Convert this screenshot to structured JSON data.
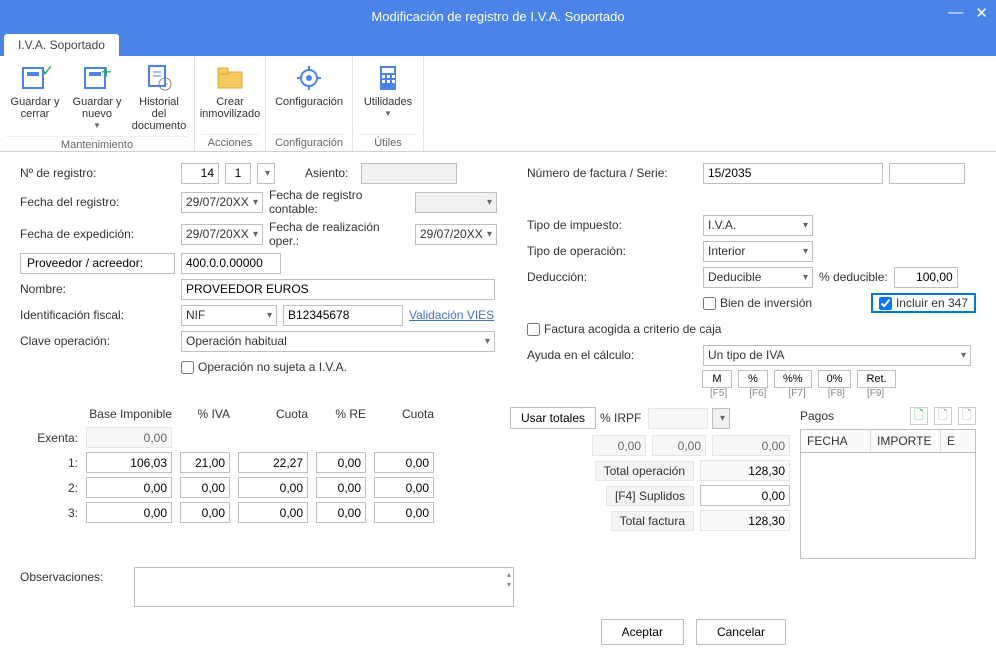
{
  "window": {
    "title": "Modificación de registro de I.V.A. Soportado"
  },
  "tab": {
    "label": "I.V.A. Soportado"
  },
  "ribbon": {
    "groups": [
      {
        "label": "Mantenimiento",
        "items": [
          {
            "label": "Guardar y cerrar",
            "dd": false
          },
          {
            "label": "Guardar y nuevo",
            "dd": true
          },
          {
            "label": "Historial del documento",
            "dd": false
          }
        ]
      },
      {
        "label": "Acciones",
        "items": [
          {
            "label": "Crear inmovilizado",
            "dd": false
          }
        ]
      },
      {
        "label": "Configuración",
        "items": [
          {
            "label": "Configuración",
            "dd": false
          }
        ]
      },
      {
        "label": "Útiles",
        "items": [
          {
            "label": "Utilidades",
            "dd": true
          }
        ]
      }
    ]
  },
  "left": {
    "nregistro_lbl": "Nº de registro:",
    "nregistro_val": "14",
    "nregistro_sub": "1",
    "fecha_registro_lbl": "Fecha del registro:",
    "fecha_registro_val": "29/07/20XX",
    "fecha_expedicion_lbl": "Fecha de expedición:",
    "fecha_expedicion_val": "29/07/20XX",
    "proveedor_btn": "Proveedor / acreedor:",
    "proveedor_val": "400.0.0.00000",
    "nombre_lbl": "Nombre:",
    "nombre_val": "PROVEEDOR EUROS",
    "id_fiscal_lbl": "Identificación fiscal:",
    "id_fiscal_tipo": "NIF",
    "id_fiscal_val": "B12345678",
    "validacion_link": "Validación VIES",
    "clave_lbl": "Clave operación:",
    "clave_val": "Operación habitual",
    "op_no_sujeta": "Operación no sujeta a I.V.A.",
    "asiento_lbl": "Asiento:",
    "fecha_contable_lbl": "Fecha de registro contable:",
    "fecha_realizacion_lbl": "Fecha de realización oper.:",
    "fecha_realizacion_val": "29/07/20XX"
  },
  "right": {
    "factura_lbl": "Número de factura / Serie:",
    "factura_val": "15/2035",
    "tipo_impuesto_lbl": "Tipo de impuesto:",
    "tipo_impuesto_val": "I.V.A.",
    "tipo_op_lbl": "Tipo de operación:",
    "tipo_op_val": "Interior",
    "deduccion_lbl": "Deducción:",
    "deduccion_val": "Deducible",
    "pct_deducible_lbl": "% deducible:",
    "pct_deducible_val": "100,00",
    "bien_inversion": "Bien de inversión",
    "incluir_347": "Incluir en 347",
    "criterio_caja": "Factura acogida a criterio de caja",
    "ayuda_lbl": "Ayuda en el cálculo:",
    "ayuda_val": "Un tipo de IVA",
    "shortcuts": [
      "M",
      "%",
      "%%",
      "0%",
      "Ret."
    ],
    "shortcut_keys": [
      "[F5]",
      "[F6]",
      "[F7]",
      "[F8]",
      "[F9]"
    ]
  },
  "grid": {
    "headers": {
      "base": "Base Imponible",
      "iva": "% IVA",
      "cuota": "Cuota",
      "re": "% RE",
      "cuota2": "Cuota",
      "usar": "Usar totales",
      "irpf": "% IRPF"
    },
    "rows": [
      {
        "lbl": "Exenta:",
        "base": "0,00",
        "iva": "",
        "cuota": "",
        "re": "",
        "cuota2": ""
      },
      {
        "lbl": "1:",
        "base": "106,03",
        "iva": "21,00",
        "cuota": "22,27",
        "re": "0,00",
        "cuota2": "0,00"
      },
      {
        "lbl": "2:",
        "base": "0,00",
        "iva": "0,00",
        "cuota": "0,00",
        "re": "0,00",
        "cuota2": "0,00"
      },
      {
        "lbl": "3:",
        "base": "0,00",
        "iva": "0,00",
        "cuota": "0,00",
        "re": "0,00",
        "cuota2": "0,00"
      }
    ],
    "irpf_vals": {
      "a": "0,00",
      "b": "0,00",
      "c": "0,00"
    },
    "totals": {
      "total_op_lbl": "Total operación",
      "total_op_val": "128,30",
      "suplidos_lbl": "[F4] Suplidos",
      "suplidos_val": "0,00",
      "total_fac_lbl": "Total factura",
      "total_fac_val": "128,30"
    }
  },
  "pagos": {
    "lbl": "Pagos",
    "cols": {
      "fecha": "FECHA",
      "importe": "IMPORTE",
      "e": "E"
    }
  },
  "obs_lbl": "Observaciones:",
  "footer": {
    "ok": "Aceptar",
    "cancel": "Cancelar"
  }
}
